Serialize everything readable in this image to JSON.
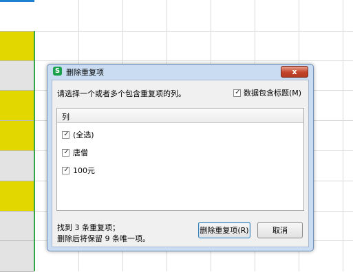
{
  "dialog": {
    "app_icon": "S",
    "title": "删除重复项",
    "close_icon": "x",
    "prompt": "请选择一个或者多个包含重复项的列。",
    "header_checkbox": {
      "label": "数据包含标题(M)",
      "checked": true
    },
    "list_header": "列",
    "columns": [
      {
        "label": "(全选)",
        "checked": true
      },
      {
        "label": "唐僧",
        "checked": true
      },
      {
        "label": "100元",
        "checked": true
      }
    ],
    "summary_line1": "找到 3 条重复项；",
    "summary_line2": "删除后将保留 9 条唯一项。",
    "delete_button": "删除重复项(R)",
    "cancel_button": "取消"
  },
  "colors": {
    "cell_yellow": "#e2d800",
    "cell_gray": "#e3e3e3",
    "selection_green": "#33a64a",
    "dialog_frame": "#c9dcf1"
  }
}
